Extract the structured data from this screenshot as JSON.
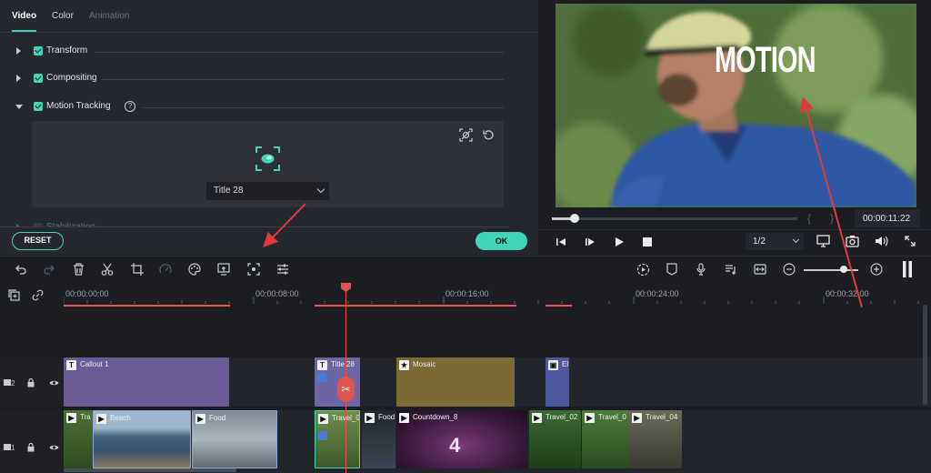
{
  "effects_panel": {
    "tabs": [
      {
        "label": "Video",
        "state": "active"
      },
      {
        "label": "Color",
        "state": "normal"
      },
      {
        "label": "Animation",
        "state": "disabled"
      }
    ],
    "sections": {
      "transform": "Transform",
      "compositing": "Compositing",
      "motion_tracking": "Motion Tracking",
      "stabilization": "Stabilization"
    },
    "help_icon_glyph": "?",
    "tracking_select_value": "Title 28",
    "reset_label": "RESET",
    "ok_label": "OK",
    "accent_color": "#3fd5b6"
  },
  "preview": {
    "overlay_text": "MOTION",
    "timecode": "00:00:11:22",
    "ratio": "1/2",
    "playback_progress": 0.08,
    "bracket_in": "{",
    "bracket_out": "}"
  },
  "toolbar": {
    "icons": [
      "undo-icon",
      "redo-icon",
      "delete-icon",
      "cut-icon",
      "crop-icon",
      "speed-icon",
      "color-icon",
      "green-screen-icon",
      "motion-tracking-icon",
      "adjust-icon",
      "render-icon",
      "marker-icon",
      "mic-icon",
      "audio-mixer-icon",
      "fit-icon",
      "zoom-out-icon",
      "zoom-in-icon",
      "pause-icon"
    ],
    "zoom_level": 0.67
  },
  "timeline": {
    "ticks": [
      "00:00:00:00",
      "00:00:08:00",
      "00:00:16:00",
      "00:00:24:00",
      "00:00:32:00"
    ],
    "track2": {
      "number": "2",
      "clips": [
        {
          "label": "Callout 1",
          "type": "T"
        },
        {
          "label": "Title 28",
          "type": "T"
        },
        {
          "label": "Mosaic",
          "type": "★"
        },
        {
          "label": "El",
          "type": "▣"
        }
      ]
    },
    "track1": {
      "number": "1",
      "clips": [
        {
          "label": "Tra",
          "type": "▶"
        },
        {
          "label": "Beach",
          "type": "▶"
        },
        {
          "label": "Food",
          "type": "▶"
        },
        {
          "label": "Travel_02",
          "type": "▶"
        },
        {
          "label": "Food",
          "type": "▶"
        },
        {
          "label": "Countdown_8",
          "type": "▶"
        },
        {
          "label": "Travel_02",
          "type": "▶"
        },
        {
          "label": "Travel_0",
          "type": "▶"
        },
        {
          "label": "Travel_04",
          "type": "▶"
        }
      ]
    },
    "countdown_digit": "4",
    "split_glyph": "✂"
  },
  "colors": {
    "playhead": "#e0554d",
    "callout_clip": "#6b5b95",
    "title_clip": "#6e65a3",
    "mosaic_clip": "#7c6a34",
    "element_clip": "#4c57a0",
    "annotation_arrow": "#e03a3a"
  }
}
